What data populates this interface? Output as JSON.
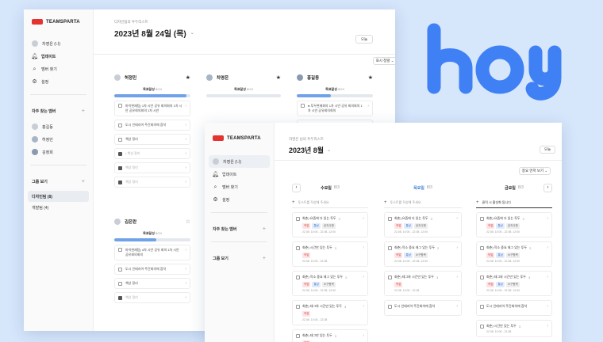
{
  "colors": {
    "accent": "#6fa2e8",
    "logo": "#e3342f",
    "today": "#3e7fd8",
    "hoy": "#3f80f5"
  },
  "brand": {
    "name": "TEAMSPARTA",
    "hoy": "hoy"
  },
  "win1": {
    "sidebar": {
      "nav": [
        {
          "label": "차영은 (나)",
          "icon": "avatar"
        },
        {
          "label": "업데이트",
          "icon": "bell-icon"
        },
        {
          "label": "멤버 찾기",
          "icon": "search-icon"
        },
        {
          "label": "설정",
          "icon": "gear-icon"
        }
      ],
      "frequent_title": "자주 찾는 멤버",
      "members": [
        "홍길동",
        "허정민",
        "김정희"
      ],
      "groups_title": "그룹 보기",
      "groups": [
        {
          "label": "디자인팀 (8)",
          "active": true
        },
        {
          "label": "개발팀 (4)",
          "active": false
        }
      ]
    },
    "crumb": "디자인팀의 투두리스트",
    "date": "2023년 8월 24일 (목)",
    "today_btn": "오늘",
    "show_all_btn": "표시 정렬",
    "columns": [
      {
        "name": "허정민",
        "starred": true,
        "progress_label": "목표달성",
        "progress_count": "8/24",
        "progress": 0.95,
        "tasks": [
          {
            "text": "마이현재팀) 1차 시안 공유 회의회의 1차 시안 공유회의회의 1차 시안",
            "checked": false,
            "two": true
          },
          {
            "text": "도시 인테리어 주간회의에 참석",
            "checked": false
          },
          {
            "text": "책상 정리",
            "checked": false
          },
          {
            "text": "• 책상 정리",
            "checked": true
          },
          {
            "text": "책상 정리",
            "checked": true
          },
          {
            "text": "책상 정리",
            "checked": true
          }
        ]
      },
      {
        "name": "차영은",
        "starred": true,
        "progress_label": "목표달성",
        "progress_count": "8/24",
        "progress": 0.0,
        "tasks": []
      },
      {
        "name": "홍길동",
        "starred": true,
        "progress_label": "목표달성",
        "progress_count": "8/24",
        "progress": 0.45,
        "tasks": [
          {
            "text": "● 투두현재회의 1차 시안 공유 회의회의 1차 시안 공유회의회의",
            "checked": false,
            "two": true
          },
          {
            "text": "● 투두현재회의 1차 시안 공유회의회의 1차 시안",
            "checked": false
          }
        ]
      },
      {
        "name": "김은란",
        "starred": false,
        "progress_label": "목표달성",
        "progress_count": "8/24",
        "progress": 0.55,
        "tasks": [
          {
            "text": "마이현재팀) 4차 시안 공유 회의 1차 시안 공유회의회의",
            "checked": false,
            "two": true
          },
          {
            "text": "도시 인테리어 주간회의에 참석",
            "checked": false
          },
          {
            "text": "책상 정리",
            "checked": false
          },
          {
            "text": "책상 정리",
            "checked": true
          }
        ]
      }
    ]
  },
  "win2": {
    "sidebar": {
      "nav": [
        {
          "label": "차영은 (나)",
          "icon": "avatar"
        },
        {
          "label": "업데이트",
          "icon": "bell-icon"
        },
        {
          "label": "멤버 찾기",
          "icon": "search-icon"
        },
        {
          "label": "설정",
          "icon": "gear-icon"
        }
      ],
      "frequent_title": "자주 찾는 멤버",
      "groups_title": "그룹 보기"
    },
    "crumb": "차영은 님의 투두리스트",
    "date": "2023년 8월",
    "today_btn": "오늘",
    "sort_btn": "중요 먼저 보기",
    "days": [
      {
        "name": "수요일",
        "count": "8/3",
        "today": false,
        "add_label": "투스트를 작성해 주세요",
        "cards": [
          {
            "title": "회춘) 요즘에 다 있는 투두",
            "num": "2",
            "tags": [
              [
                "작업",
                "red"
              ],
              [
                "통상",
                "blue"
              ],
              [
                "공지사항",
                "gray"
              ]
            ],
            "due": "22.08. 10:00 - 22.08. 12:00"
          },
          {
            "title": "회춘) 시간만 있는 투두",
            "num": "3",
            "tags": [
              [
                "작업",
                "red"
              ]
            ],
            "due": "22.08. 10:00 - 22.08"
          },
          {
            "title": "회춘) 작소 중요 태그 있는 투두",
            "num": "2",
            "tags": [
              [
                "작업",
                "red"
              ],
              [
                "통상",
                "blue"
              ],
              [
                "소구항목",
                "gray"
              ]
            ],
            "due": "22.08. 10:00 - 22.08. 12:00"
          },
          {
            "title": "회춘) 태그와 시간만 있는 투두",
            "num": "3",
            "tags": [
              [
                "작업",
                "red"
              ]
            ],
            "due": "22.08. 10:00 - 22.08"
          },
          {
            "title": "회춘) 태그만 있는 투두",
            "num": "3",
            "tags": [
              [
                "작업",
                "red"
              ]
            ],
            "due": ""
          }
        ]
      },
      {
        "name": "목요일",
        "count": "8/3",
        "today": true,
        "add_label": "투스트를 작성해 주세요",
        "cards": [
          {
            "title": "회춘) 요즘에 다 있는 투두",
            "num": "3",
            "tags": [
              [
                "작업",
                "red"
              ],
              [
                "통상",
                "blue"
              ],
              [
                "공지사항",
                "gray"
              ]
            ],
            "due": "22.08. 10:00 - 22.08. 12:00"
          },
          {
            "title": "회춘) 작소 중요 태그 있는 투두",
            "num": "2",
            "tags": [
              [
                "작업",
                "red"
              ],
              [
                "통상",
                "blue"
              ],
              [
                "소구항목",
                "gray"
              ]
            ],
            "due": "22.08. 10:00 - 22.08. 12:00"
          },
          {
            "title": "회춘) 태그와 시간만 있는 투두",
            "num": "3",
            "tags": [
              [
                "작업",
                "red"
              ]
            ],
            "due": "22.08. 10:00 - 22.08"
          },
          {
            "title": "도시 인테리어 주간회의에 참석",
            "num": "",
            "tags": [],
            "due": ""
          }
        ]
      },
      {
        "name": "금요일",
        "count": "8/3",
        "today": false,
        "add_label": "클릭 시 활성화 됩니다",
        "cards": [
          {
            "title": "회춘) 요즘에 다 있는 투두",
            "num": "2",
            "tags": [
              [
                "작업",
                "red"
              ],
              [
                "통상",
                "blue"
              ],
              [
                "공지사항",
                "gray"
              ]
            ],
            "due": "22.08. 10:00 - 22.08. 12:00"
          },
          {
            "title": "회춘) 작소 중요 태그 있는 투두",
            "num": "2",
            "tags": [
              [
                "작업",
                "red"
              ],
              [
                "통상",
                "blue"
              ],
              [
                "소구항목",
                "gray"
              ]
            ],
            "due": "22.08. 10:00 - 22.08. 12:00"
          },
          {
            "title": "회춘) 태그와 시간만 있는 투두",
            "num": "3",
            "tags": [
              [
                "작업",
                "red"
              ],
              [
                "통상",
                "blue"
              ],
              [
                "소구항목",
                "gray"
              ]
            ],
            "due": "22.08. 10:00 - 22.08. 12:00"
          },
          {
            "title": "도시 인테리어 주간회의에 참석",
            "num": "",
            "tags": [],
            "due": ""
          },
          {
            "title": "회춘) 시간만 있는 투두",
            "num": "3",
            "tags": [],
            "due": "22.08. 10:00 - 22.08"
          }
        ]
      }
    ]
  }
}
